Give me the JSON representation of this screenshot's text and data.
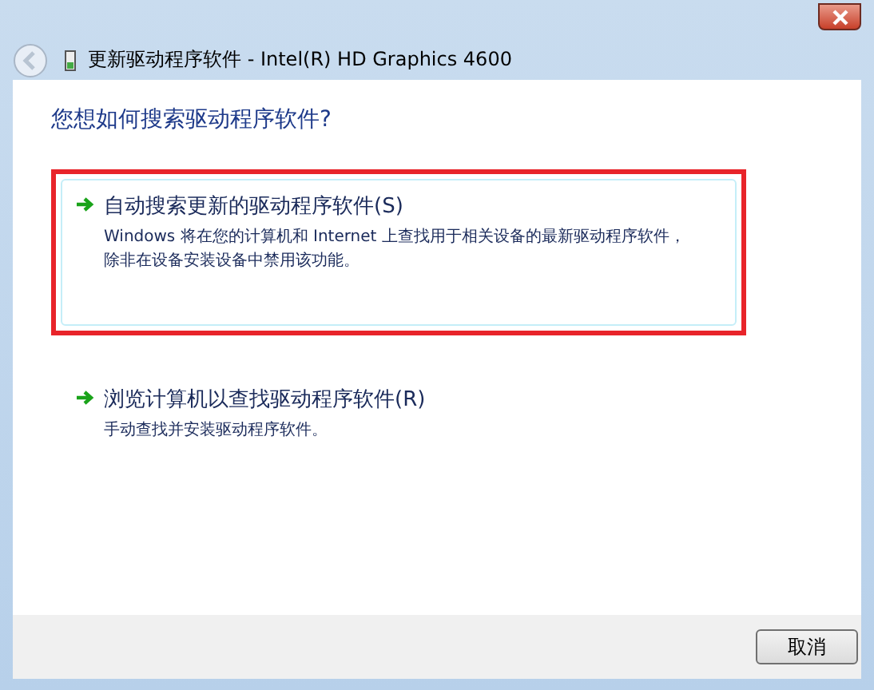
{
  "window": {
    "title": "更新驱动程序软件 - Intel(R) HD Graphics 4600"
  },
  "heading": "您想如何搜索驱动程序软件?",
  "options": [
    {
      "title": "自动搜索更新的驱动程序软件(S)",
      "description": "Windows 将在您的计算机和 Internet 上查找用于相关设备的最新驱动程序软件，除非在设备安装设备中禁用该功能。",
      "highlighted": true
    },
    {
      "title": "浏览计算机以查找驱动程序软件(R)",
      "description": "手动查找并安装驱动程序软件。",
      "highlighted": false
    }
  ],
  "buttons": [
    "取消"
  ]
}
